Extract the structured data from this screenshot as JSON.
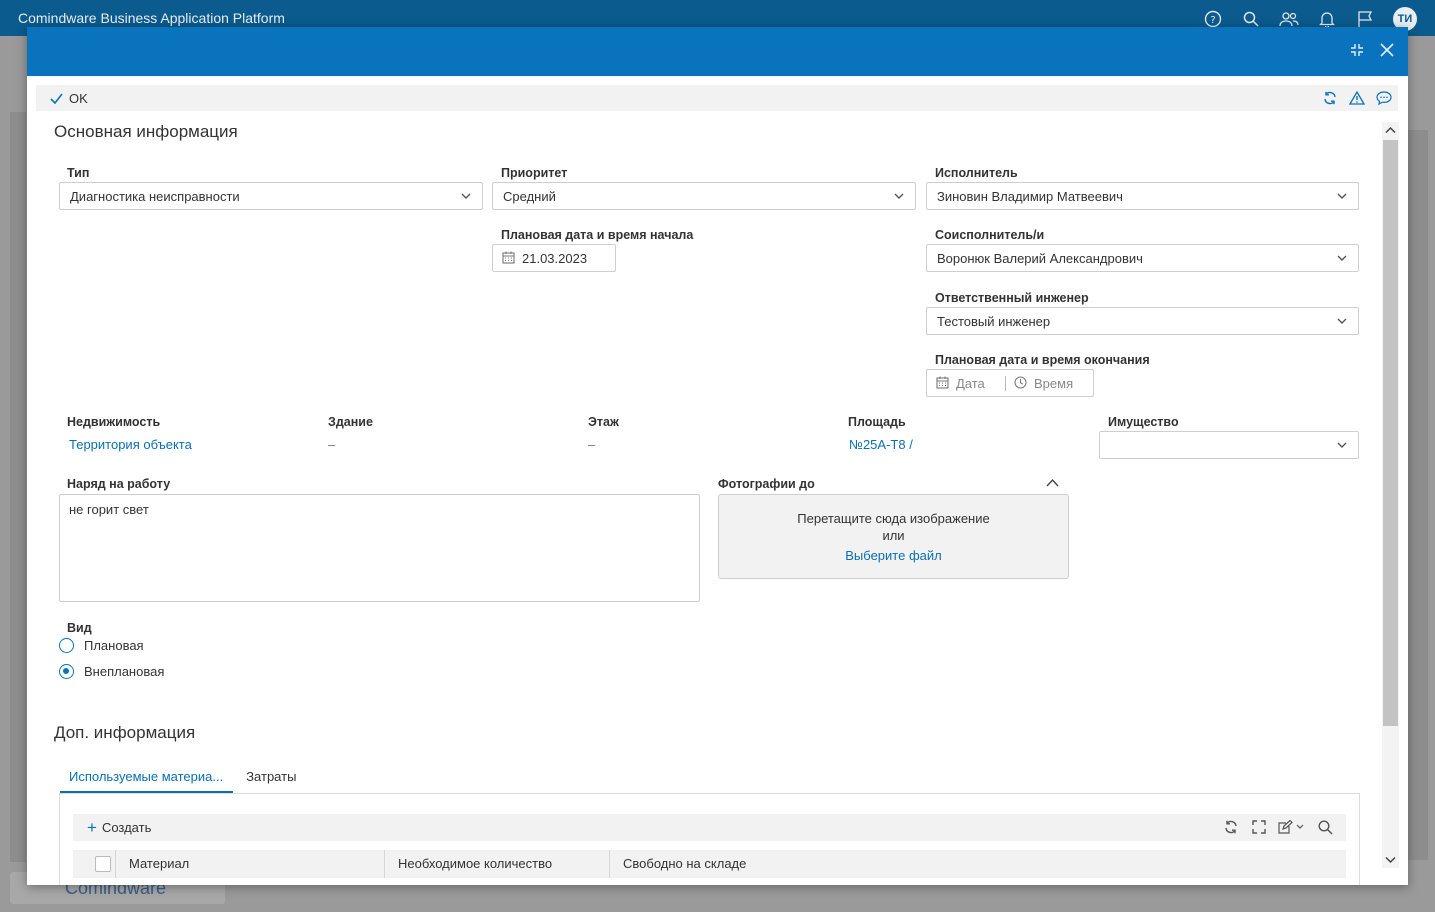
{
  "app": {
    "title": "Comindware Business Application Platform",
    "avatar_initials": "ТИ",
    "logo_text": "Comindware"
  },
  "toolbar": {
    "ok_label": "OK"
  },
  "main_section": {
    "title": "Основная информация"
  },
  "fields": {
    "type": {
      "label": "Тип",
      "value": "Диагностика неисправности"
    },
    "priority": {
      "label": "Приоритет",
      "value": "Средний"
    },
    "executor": {
      "label": "Исполнитель",
      "value": "Зиновин Владимир Матвеевич"
    },
    "planned_start": {
      "label": "Плановая дата и время начала",
      "value": "21.03.2023"
    },
    "coexecutor": {
      "label": "Соисполнитель/и",
      "value": "Воронюк Валерий Александрович"
    },
    "engineer": {
      "label": "Ответственный инженер",
      "value": "Тестовый инженер"
    },
    "planned_end": {
      "label": "Плановая дата и время окончания",
      "date_placeholder": "Дата",
      "time_placeholder": "Время"
    },
    "real_estate": {
      "label": "Недвижимость",
      "value": "Территория объекта"
    },
    "building": {
      "label": "Здание",
      "value": "–"
    },
    "floor": {
      "label": "Этаж",
      "value": "–"
    },
    "area": {
      "label": "Площадь",
      "value": "№25А-Т8 /"
    },
    "property": {
      "label": "Имущество",
      "value": ""
    },
    "work_order": {
      "label": "Наряд на работу",
      "value": "не горит свет"
    },
    "photos": {
      "label": "Фотографии до",
      "drop_text": "Перетащите сюда изображение",
      "or_text": "или",
      "choose_file": "Выберите файл"
    },
    "kind": {
      "label": "Вид",
      "options": [
        {
          "label": "Плановая",
          "selected": false
        },
        {
          "label": "Внеплановая",
          "selected": true
        }
      ]
    }
  },
  "extra_section": {
    "title": "Доп. информация",
    "tabs": [
      {
        "label": "Используемые материа...",
        "active": true
      },
      {
        "label": "Затраты",
        "active": false
      }
    ],
    "grid": {
      "create_label": "Создать",
      "columns": [
        "Материал",
        "Необходимое количество",
        "Свободно на складе"
      ]
    }
  },
  "colors": {
    "header": "#0b5b8e",
    "modal_header": "#0a73be",
    "link": "#0a6fb3"
  }
}
